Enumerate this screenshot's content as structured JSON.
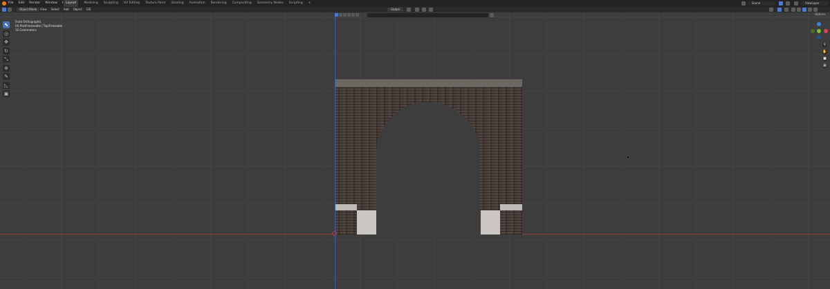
{
  "menu": [
    "File",
    "Edit",
    "Render",
    "Window",
    "Help"
  ],
  "workspaces": [
    "Layout",
    "Modeling",
    "Sculpting",
    "UV Editing",
    "Texture Paint",
    "Shading",
    "Animation",
    "Rendering",
    "Compositing",
    "Geometry Nodes",
    "Scripting"
  ],
  "active_workspace": "Layout",
  "scene_name": "Scene",
  "view_layer": "ViewLayer",
  "header": {
    "mode": "Object Mode",
    "view_menu": [
      "View",
      "Select",
      "Add",
      "Object",
      "GIS"
    ],
    "transform_orientation": "Global",
    "options_label": "Options"
  },
  "overlay": {
    "line1": "Front Orthographic",
    "line2": "(0) PostFreezeable | Top/Freezable",
    "line3": "10 Centimeters"
  },
  "tools": [
    "select-box",
    "cursor",
    "move",
    "rotate",
    "scale",
    "transform",
    "annotate",
    "measure",
    "add-cube"
  ],
  "nav_icons": [
    "zoom-icon",
    "pan-icon",
    "camera-icon",
    "grid-icon"
  ],
  "colors": {
    "viewport_bg": "#3d3d3d",
    "x_axis": "#8f3d3d",
    "z_axis": "#3e5fa0",
    "active_tool": "#4772b3"
  }
}
